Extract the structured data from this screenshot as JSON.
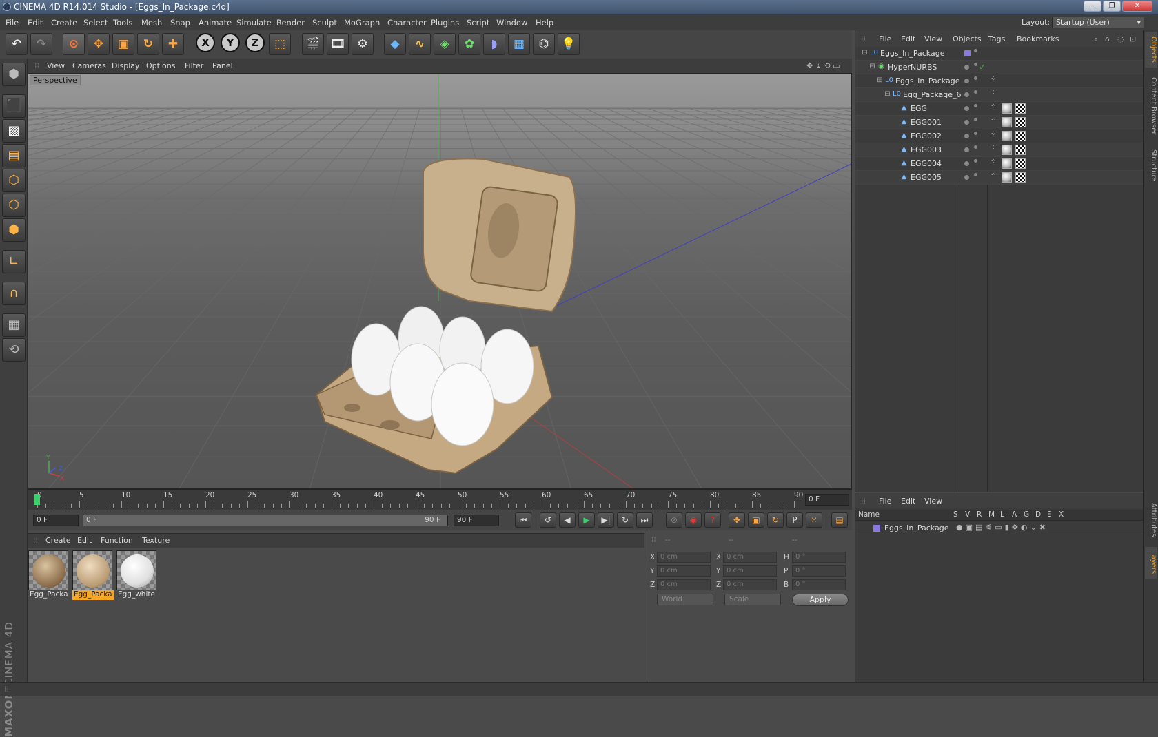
{
  "window": {
    "title": "CINEMA 4D R14.014 Studio - [Eggs_In_Package.c4d]",
    "minimize": "–",
    "restore": "❐",
    "close": "✕"
  },
  "menu": [
    "File",
    "Edit",
    "Create",
    "Select",
    "Tools",
    "Mesh",
    "Snap",
    "Animate",
    "Simulate",
    "Render",
    "Sculpt",
    "MoGraph",
    "Character",
    "Plugins",
    "Script",
    "Window",
    "Help"
  ],
  "layout": {
    "label": "Layout:",
    "value": "Startup (User)"
  },
  "toolbar_icons": [
    "undo-icon",
    "redo-icon",
    "select-live-icon",
    "move-icon",
    "scale-icon",
    "rotate-icon",
    "add-icon",
    "x-axis-icon",
    "y-axis-icon",
    "z-axis-icon",
    "coord-system-icon",
    "render-view-icon",
    "render-picture-viewer-icon",
    "render-settings-icon",
    "cube-icon",
    "spline-icon",
    "nurbs-icon",
    "array-icon",
    "deformer-icon",
    "floor-icon",
    "camera-icon",
    "light-icon"
  ],
  "axis_labels": {
    "x": "X",
    "y": "Y",
    "z": "Z"
  },
  "viewport": {
    "menu": [
      "View",
      "Cameras",
      "Display",
      "Options",
      "Filter",
      "Panel"
    ],
    "label": "Perspective",
    "axes": {
      "y": "Y",
      "z": "Z",
      "x": "X"
    }
  },
  "timeline": {
    "ticks": [
      "0",
      "5",
      "10",
      "15",
      "20",
      "25",
      "30",
      "35",
      "40",
      "45",
      "50",
      "55",
      "60",
      "65",
      "70",
      "75",
      "80",
      "85",
      "90"
    ],
    "current": "0 F"
  },
  "playback": {
    "start": "0 F",
    "range_start": "0 F",
    "range_end": "90 F",
    "end": "90 F"
  },
  "materials": {
    "menu": [
      "Create",
      "Edit",
      "Function",
      "Texture"
    ],
    "items": [
      {
        "name": "Egg_Packa",
        "selected": false,
        "color": "#9a7a5a"
      },
      {
        "name": "Egg_Packa",
        "selected": true,
        "color": "#c8a880"
      },
      {
        "name": "Egg_white",
        "selected": false,
        "color": "#f2f2f2"
      }
    ]
  },
  "coords": {
    "headers": [
      "--",
      "--",
      "--"
    ],
    "rows": [
      {
        "a": "X",
        "av": "0 cm",
        "b": "X",
        "bv": "0 cm",
        "c": "H",
        "cv": "0 °"
      },
      {
        "a": "Y",
        "av": "0 cm",
        "b": "Y",
        "bv": "0 cm",
        "c": "P",
        "cv": "0 °"
      },
      {
        "a": "Z",
        "av": "0 cm",
        "b": "Z",
        "bv": "0 cm",
        "c": "B",
        "cv": "0 °"
      }
    ],
    "mode": "World",
    "type": "Scale",
    "apply": "Apply"
  },
  "objects": {
    "menu": [
      "File",
      "Edit",
      "View",
      "Objects",
      "Tags",
      "Bookmarks"
    ],
    "rows": [
      {
        "name": "Eggs_In_Package",
        "icon": "L0",
        "indent": 0
      },
      {
        "name": "HyperNURBS",
        "icon": "◉",
        "indent": 1
      },
      {
        "name": "Eggs_In_Package",
        "icon": "L0",
        "indent": 2
      },
      {
        "name": "Egg_Package_6",
        "icon": "L0",
        "indent": 3
      },
      {
        "name": "EGG",
        "icon": "▲",
        "indent": 4
      },
      {
        "name": "EGG001",
        "icon": "▲",
        "indent": 4
      },
      {
        "name": "EGG002",
        "icon": "▲",
        "indent": 4
      },
      {
        "name": "EGG003",
        "icon": "▲",
        "indent": 4
      },
      {
        "name": "EGG004",
        "icon": "▲",
        "indent": 4
      },
      {
        "name": "EGG005",
        "icon": "▲",
        "indent": 4
      }
    ],
    "check": "✓"
  },
  "layers": {
    "menu": [
      "File",
      "Edit",
      "View"
    ],
    "columns": [
      "Name",
      "S",
      "V",
      "R",
      "M",
      "L",
      "A",
      "G",
      "D",
      "E",
      "X"
    ],
    "rows": [
      {
        "name": "Eggs_In_Package",
        "color": "#8a7ae0"
      }
    ]
  },
  "side_tabs": [
    "Objects",
    "Content Browser",
    "Structure",
    "Attributes",
    "Layers"
  ],
  "brand": {
    "line1": "MAXON",
    "line2": "CINEMA 4D"
  }
}
